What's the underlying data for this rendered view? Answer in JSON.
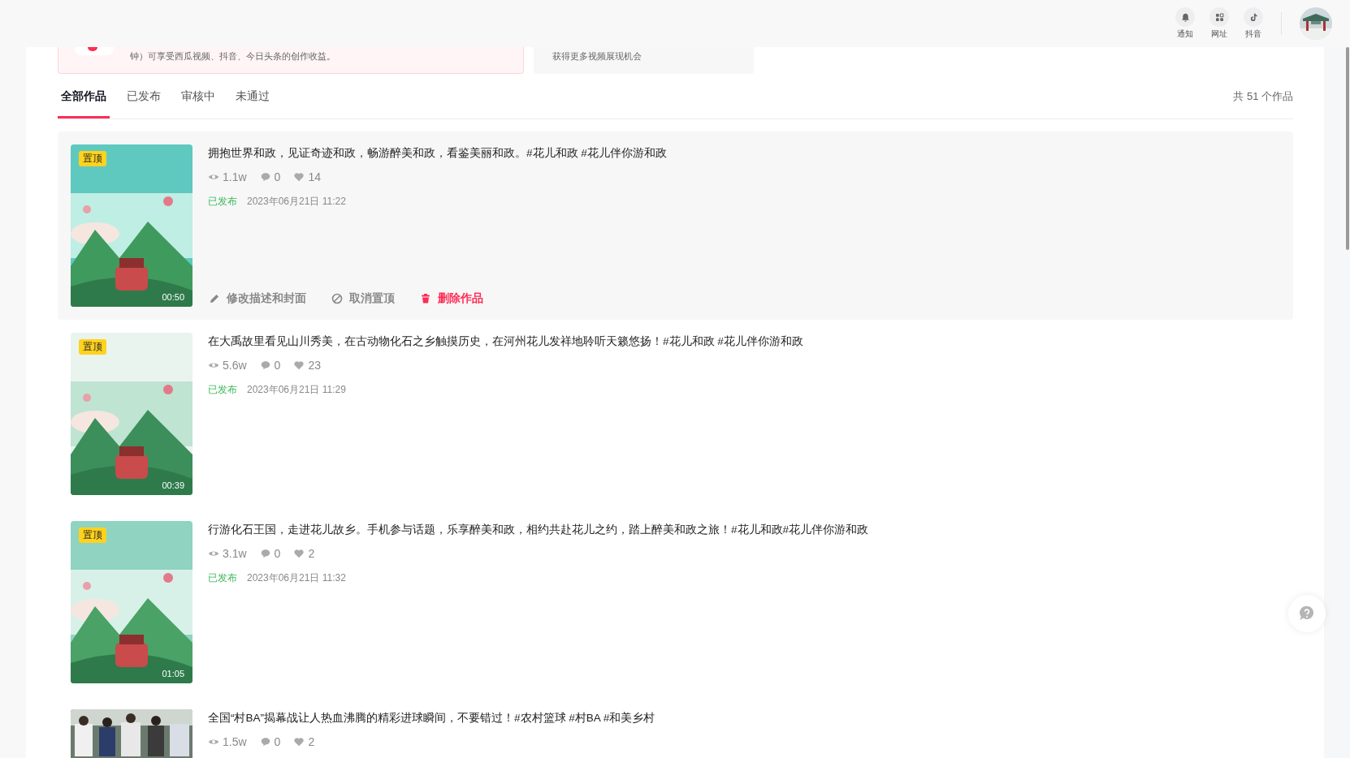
{
  "header": {
    "nav": [
      {
        "kind": "bell",
        "label": "通知"
      },
      {
        "kind": "grid",
        "label": "网址"
      },
      {
        "kind": "note",
        "label": "抖音"
      }
    ]
  },
  "banners": [
    {
      "text": "钟）可享受西瓜视频、抖音、今日头条的创作收益。"
    },
    {
      "text": "获得更多视频展现机会"
    }
  ],
  "tabs": [
    {
      "label": "全部作品",
      "selected": true
    },
    {
      "label": "已发布",
      "selected": false
    },
    {
      "label": "审核中",
      "selected": false
    },
    {
      "label": "未通过",
      "selected": false
    }
  ],
  "count": "共 51 个作品",
  "works": [
    {
      "title": "拥抱世界和政，见证奇迹和政，畅游醉美和政，看鉴美丽和政。#花儿和政 #花儿伴你游和政",
      "views": "1.1w",
      "comments": "0",
      "likes": "14",
      "pinned": true,
      "pin_label": "置顶",
      "duration": "00:50",
      "status": "已发布",
      "time": "2023年06月21日 11:22",
      "actions": [
        {
          "kind": "edit",
          "label": "修改描述和封面"
        },
        {
          "kind": "unpin",
          "label": "取消置顶"
        },
        {
          "kind": "delete",
          "label": "删除作品"
        }
      ]
    },
    {
      "title": "在大禹故里看见山川秀美，在古动物化石之乡触摸历史，在河州花儿发祥地聆听天籁悠扬！#花儿和政 #花儿伴你游和政",
      "views": "5.6w",
      "comments": "0",
      "likes": "23",
      "pinned": true,
      "pin_label": "置顶",
      "duration": "00:39",
      "status": "已发布",
      "time": "2023年06月21日 11:29"
    },
    {
      "title": "行游化石王国，走进花儿故乡。手机参与话题，乐享醉美和政，相约共赴花儿之约，踏上醉美和政之旅！#花儿和政#花儿伴你游和政",
      "views": "3.1w",
      "comments": "0",
      "likes": "2",
      "pinned": true,
      "pin_label": "置顶",
      "duration": "01:05",
      "status": "已发布",
      "time": "2023年06月21日 11:32"
    },
    {
      "title": "全国“村BA”揭幕战让人热血沸腾的精彩进球瞬间，不要错过！#农村篮球 #村BA #和美乡村",
      "views": "1.5w",
      "comments": "0",
      "likes": "2",
      "pinned": false
    }
  ]
}
